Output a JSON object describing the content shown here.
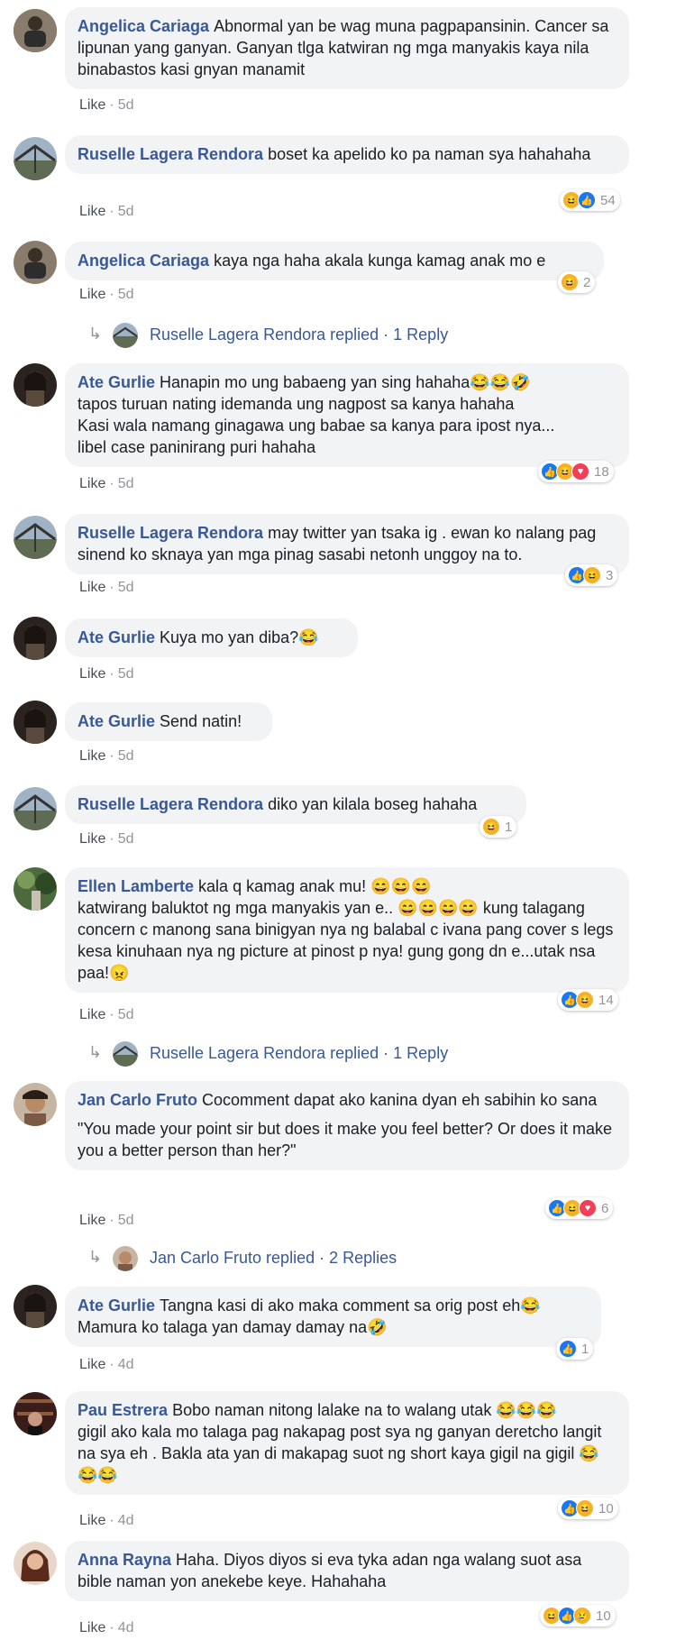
{
  "comments": [
    {
      "name": "Angelica Cariaga",
      "text": "Abnormal yan be wag muna pagpapansinin. Cancer sa lipunan yang ganyan. Ganyan tlga katwiran ng mga manyakis kaya nila binabastos kasi gnyan manamit",
      "like": "Like",
      "time": "5d",
      "avatar": "rider-avatar"
    },
    {
      "name": "Ruselle Lagera Rendora",
      "text": "boset ka apelido ko pa naman sya hahahaha",
      "like": "Like",
      "time": "5d",
      "reaction_count": "54",
      "avatar": "bridge-avatar"
    },
    {
      "name": "Angelica Cariaga",
      "text": "kaya nga haha akala kunga kamag anak mo e",
      "like": "Like",
      "time": "5d",
      "reaction_count": "2",
      "avatar": "rider-avatar"
    },
    {
      "name": "Ate Gurlie",
      "text": "Hanapin mo ung babaeng yan sing hahaha😂😂🤣\ntapos turuan nating idemanda ung nagpost sa kanya hahaha\nKasi wala namang ginagawa ung babae sa kanya para ipost nya...\nlibel case paninirang puri hahaha",
      "like": "Like",
      "time": "5d",
      "reaction_count": "18",
      "avatar": "woman-avatar"
    },
    {
      "name": "Ruselle Lagera Rendora",
      "text": "may twitter yan tsaka ig . ewan ko nalang pag sinend ko sknaya yan mga pinag sasabi netonh unggoy na to.",
      "like": "Like",
      "time": "5d",
      "reaction_count": "3",
      "avatar": "bridge-avatar"
    },
    {
      "name": "Ate Gurlie",
      "text": "Kuya mo yan diba?😂",
      "like": "Like",
      "time": "5d",
      "avatar": "woman-avatar"
    },
    {
      "name": "Ate Gurlie",
      "text": "Send natin!",
      "like": "Like",
      "time": "5d",
      "avatar": "woman-avatar"
    },
    {
      "name": "Ruselle Lagera Rendora",
      "text": "diko yan kilala boseg hahaha",
      "like": "Like",
      "time": "5d",
      "reaction_count": "1",
      "avatar": "bridge-avatar"
    },
    {
      "name": "Ellen Lamberte",
      "text": "kala q kamag anak mu! 😄😄😄\nkatwirang baluktot ng mga manyakis yan e.. 😄😄😄😄 kung talagang concern c manong sana binigyan nya ng balabal c ivana pang cover s legs kesa kinuhaan nya ng picture at pinost p nya! gung gong dn e...utak nsa paa!😠",
      "like": "Like",
      "time": "5d",
      "reaction_count": "14",
      "avatar": "forest-avatar"
    },
    {
      "name": "Jan Carlo Fruto",
      "text": "Cocomment dapat ako kanina dyan eh sabihin ko sana",
      "text2": "\"You made your point sir but does it make you feel better? Or does it make you a better person than her?\"",
      "like": "Like",
      "time": "5d",
      "reaction_count": "6",
      "avatar": "man-avatar"
    },
    {
      "name": "Ate Gurlie",
      "text": "Tangna kasi di ako maka comment sa orig post eh😂\nMamura ko talaga yan damay damay na🤣",
      "like": "Like",
      "time": "4d",
      "reaction_count": "1",
      "avatar": "woman-avatar"
    },
    {
      "name": "Pau Estrera",
      "text": "Bobo naman nitong lalake na to walang utak 😂😂😂\ngigil ako kala mo talaga pag nakapag post sya ng ganyan deretcho langit na sya eh . Bakla ata yan di makapag suot ng short kaya gigil na gigil 😂😂😂",
      "like": "Like",
      "time": "4d",
      "reaction_count": "10",
      "avatar": "shelf-avatar"
    },
    {
      "name": "Anna Rayna",
      "text": "Haha. Diyos diyos si eva tyka adan nga walang suot asa bible naman yon anekebe keye. Hahahaha",
      "like": "Like",
      "time": "4d",
      "reaction_count": "10",
      "avatar": "girl-avatar"
    }
  ],
  "replies": [
    {
      "label": "Ruselle Lagera Rendora replied · 1 Reply"
    },
    {
      "label": "Ruselle Lagera Rendora replied · 1 Reply"
    },
    {
      "label": "Jan Carlo Fruto replied · 2 Replies"
    }
  ],
  "colors": {
    "name": "#385898",
    "bubble": "#f2f3f5",
    "meta": "#90949c",
    "like_reaction": "#1877f2",
    "love_reaction": "#f33e58",
    "haha_reaction": "#f7b125"
  }
}
